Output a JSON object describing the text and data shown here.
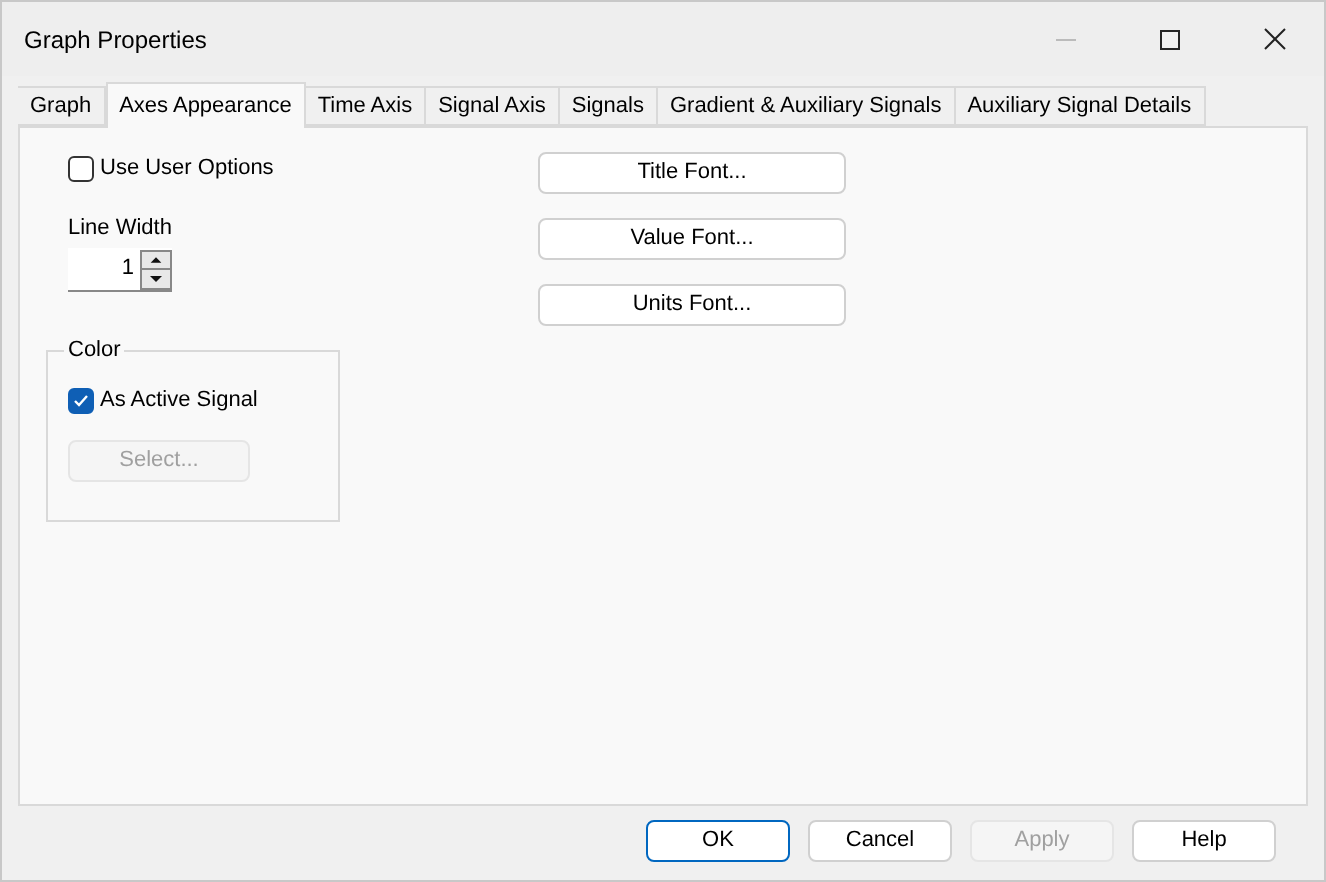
{
  "window": {
    "title": "Graph Properties"
  },
  "tabs": [
    {
      "label": "Graph",
      "selected": false
    },
    {
      "label": "Axes Appearance",
      "selected": true
    },
    {
      "label": "Time Axis",
      "selected": false
    },
    {
      "label": "Signal Axis",
      "selected": false
    },
    {
      "label": "Signals",
      "selected": false
    },
    {
      "label": "Gradient & Auxiliary Signals",
      "selected": false
    },
    {
      "label": "Auxiliary Signal Details",
      "selected": false
    }
  ],
  "use_user_options": {
    "label": "Use User Options",
    "checked": false
  },
  "line_width": {
    "label": "Line Width",
    "value": "1"
  },
  "color_group": {
    "title": "Color",
    "as_active_signal": {
      "label": "As Active Signal",
      "checked": true
    },
    "select_button": {
      "label": "Select...",
      "disabled": true
    }
  },
  "font_buttons": [
    "Title Font...",
    "Value Font...",
    "Units Font..."
  ],
  "footer_buttons": [
    {
      "label": "OK",
      "default": true,
      "disabled": false
    },
    {
      "label": "Cancel",
      "default": false,
      "disabled": false
    },
    {
      "label": "Apply",
      "default": false,
      "disabled": true
    },
    {
      "label": "Help",
      "default": false,
      "disabled": false
    }
  ]
}
